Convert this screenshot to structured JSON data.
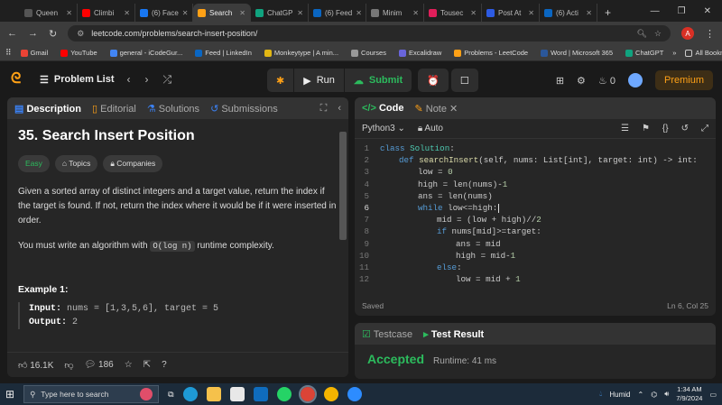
{
  "browser": {
    "tabs": [
      {
        "label": "Queen",
        "color": "#555555",
        "active": false
      },
      {
        "label": "Climbi",
        "color": "#ff0000",
        "active": false
      },
      {
        "label": "(6) Face",
        "color": "#1877f2",
        "active": false
      },
      {
        "label": "Search",
        "color": "#ffa116",
        "active": true
      },
      {
        "label": "ChatGP",
        "color": "#10a37f",
        "active": false
      },
      {
        "label": "(6) Feed",
        "color": "#0a66c2",
        "active": false
      },
      {
        "label": "Minim",
        "color": "#777777",
        "active": false
      },
      {
        "label": "Tousec",
        "color": "#e01e5a",
        "active": false
      },
      {
        "label": "Post At",
        "color": "#2d5be3",
        "active": false
      },
      {
        "label": "(6) Acti",
        "color": "#0a66c2",
        "active": false
      }
    ],
    "new_tab": "+",
    "url": "leetcode.com/problems/search-insert-position/",
    "profile_initial": "A",
    "bookmarks": [
      {
        "label": "Gmail",
        "color": "#ea4335"
      },
      {
        "label": "YouTube",
        "color": "#ff0000"
      },
      {
        "label": "general - iCodeGur...",
        "color": "#4285f4"
      },
      {
        "label": "Feed | LinkedIn",
        "color": "#0a66c2"
      },
      {
        "label": "Monkeytype | A min...",
        "color": "#e2b714"
      },
      {
        "label": "Courses",
        "color": "#999999"
      },
      {
        "label": "Excalidraw",
        "color": "#6965db"
      },
      {
        "label": "Problems - LeetCode",
        "color": "#ffa116"
      },
      {
        "label": "Word | Microsoft 365",
        "color": "#2b579a"
      },
      {
        "label": "ChatGPT",
        "color": "#10a37f"
      }
    ],
    "all_bookmarks": "All Bookmarks"
  },
  "nav": {
    "problem_list": "Problem List",
    "run": "Run",
    "submit": "Submit",
    "streak_count": "0",
    "premium": "Premium"
  },
  "description_panel": {
    "tabs": [
      "Description",
      "Editorial",
      "Solutions",
      "Submissions"
    ],
    "title": "35. Search Insert Position",
    "pills": [
      "Easy",
      "Topics",
      "Companies"
    ],
    "paragraph1": "Given a sorted array of distinct integers and a target value, return the index if the target is found. If not, return the index where it would be if it were inserted in order.",
    "paragraph2_before": "You must write an algorithm with ",
    "paragraph2_code": "O(log n)",
    "paragraph2_after": " runtime complexity.",
    "example_heading": "Example 1:",
    "example_input_label": "Input:",
    "example_input": " nums = [1,3,5,6], target = 5",
    "example_output_label": "Output:",
    "example_output": " 2",
    "likes": "16.1K",
    "comments": "186"
  },
  "code_panel": {
    "tabs": [
      "Code",
      "Note"
    ],
    "language": "Python3",
    "mode": "Auto",
    "status": "Saved",
    "cursor": "Ln 6, Col 25",
    "lines": [
      {
        "n": "1",
        "indent": 0,
        "parts": [
          [
            "kw",
            "class "
          ],
          [
            "cls",
            "Solution"
          ],
          [
            "txt",
            ":"
          ]
        ]
      },
      {
        "n": "2",
        "indent": 1,
        "parts": [
          [
            "kw",
            "def "
          ],
          [
            "fn",
            "searchInsert"
          ],
          [
            "txt",
            "(self, nums: List[int], target: int) -> int:"
          ]
        ]
      },
      {
        "n": "3",
        "indent": 2,
        "parts": [
          [
            "txt",
            "low = "
          ],
          [
            "num",
            "0"
          ]
        ]
      },
      {
        "n": "4",
        "indent": 2,
        "parts": [
          [
            "txt",
            "high = len(nums)-"
          ],
          [
            "num",
            "1"
          ]
        ]
      },
      {
        "n": "5",
        "indent": 2,
        "parts": [
          [
            "txt",
            "ans = len(nums)"
          ]
        ]
      },
      {
        "n": "6",
        "indent": 2,
        "parts": [
          [
            "kw",
            "while "
          ],
          [
            "txt",
            "low<=high:"
          ]
        ]
      },
      {
        "n": "7",
        "indent": 3,
        "parts": [
          [
            "txt",
            "mid = (low + high)//"
          ],
          [
            "num",
            "2"
          ]
        ]
      },
      {
        "n": "8",
        "indent": 3,
        "parts": [
          [
            "kw",
            "if "
          ],
          [
            "txt",
            "nums[mid]>=target:"
          ]
        ]
      },
      {
        "n": "9",
        "indent": 4,
        "parts": [
          [
            "txt",
            "ans = mid"
          ]
        ]
      },
      {
        "n": "10",
        "indent": 4,
        "parts": [
          [
            "txt",
            "high = mid-"
          ],
          [
            "num",
            "1"
          ]
        ]
      },
      {
        "n": "11",
        "indent": 3,
        "parts": [
          [
            "kw",
            "else"
          ],
          [
            "txt",
            ":"
          ]
        ]
      },
      {
        "n": "12",
        "indent": 4,
        "parts": [
          [
            "txt",
            "low = mid + "
          ],
          [
            "num",
            "1"
          ]
        ]
      }
    ]
  },
  "result_panel": {
    "tabs": [
      "Testcase",
      "Test Result"
    ],
    "verdict": "Accepted",
    "runtime": "Runtime: 41 ms"
  },
  "taskbar": {
    "search_placeholder": "Type here to search",
    "weather": "Humid",
    "time": "1:34 AM",
    "date": "7/9/2024"
  }
}
